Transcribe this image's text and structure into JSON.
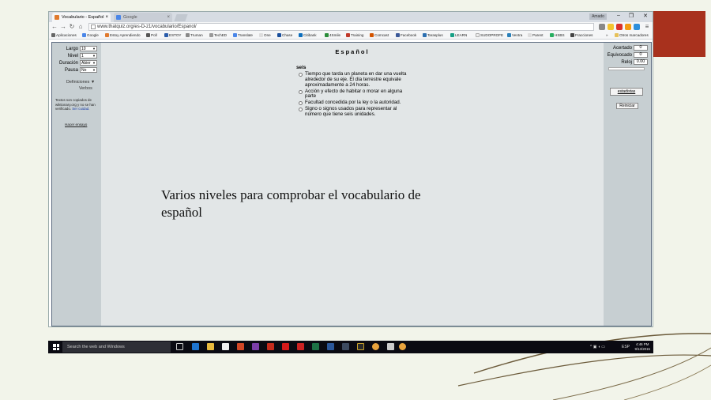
{
  "browser": {
    "tabs": [
      {
        "label": "Vocabulario - Español",
        "active": true
      },
      {
        "label": "Google",
        "active": false
      }
    ],
    "user_badge": "Amado",
    "window_controls": [
      "–",
      "❐",
      "✕"
    ],
    "url": "www.thatquiz.org/es-D-z1/vocabulario/Espanol/",
    "bookmarks": [
      "Aplicaciones",
      "Google",
      "Estoy Aprendiendo",
      "Poll",
      "ESTOY",
      "Truman",
      "TechED",
      "Translate",
      "One",
      "Chase",
      "Citibank",
      "4Smile",
      "Training",
      "Comcast",
      "Facebook",
      "Tarasplus",
      "LEARN",
      "SUDOPROFE",
      "Ventra",
      "Parent",
      "HSBS",
      "Fracciones"
    ],
    "bookmarks_more": "»",
    "other_bookmarks": "Otros marcadores"
  },
  "settings": {
    "rows": [
      {
        "label": "Largo",
        "value": "10"
      },
      {
        "label": "Nivel",
        "value": "1"
      },
      {
        "label": "Duración",
        "value": "Abier"
      },
      {
        "label": "Pausa",
        "value": "No"
      }
    ],
    "definitions_label": "Definiciones ▼",
    "verbs_label": "Verbos",
    "note_text": "Textos son copiados de wiktionary.org y no se han verificado.",
    "note_link": "Ser cuidad.",
    "print_link": "Hacer ensayo"
  },
  "quiz": {
    "title": "Español",
    "word": "seis",
    "choices": [
      "Tiempo que tarda un planeta en dar una vuelta alrededor de su eje. El día terrestre equivale aproximadamente a 24 horas.",
      "Acción y efecto de habitar o morar en alguna parte",
      "Facultad concedida por la ley o la autoridad.",
      "Signo o signos usados para representar al número que tiene seis unidades."
    ]
  },
  "score": {
    "correct_label": "Acertado",
    "correct_value": "0",
    "wrong_label": "Equivocado",
    "wrong_value": "0",
    "clock_label": "Reloj",
    "clock_value": "0.00",
    "stats_button": "estadistas",
    "restart_button": "Reiniciar"
  },
  "caption": "Varios niveles para comprobar el vocabulario de español",
  "taskbar": {
    "search_placeholder": "Search the web and Windows",
    "language": "ESP",
    "time": "4:46 PM",
    "date": "9/13/2015"
  },
  "colors": {
    "slide_bg": "#f2f4ea",
    "accent_red": "#a8311d",
    "panel": "#c7cfd2",
    "page_border": "#5c6b7f",
    "taskbar": "#0a0a12"
  }
}
